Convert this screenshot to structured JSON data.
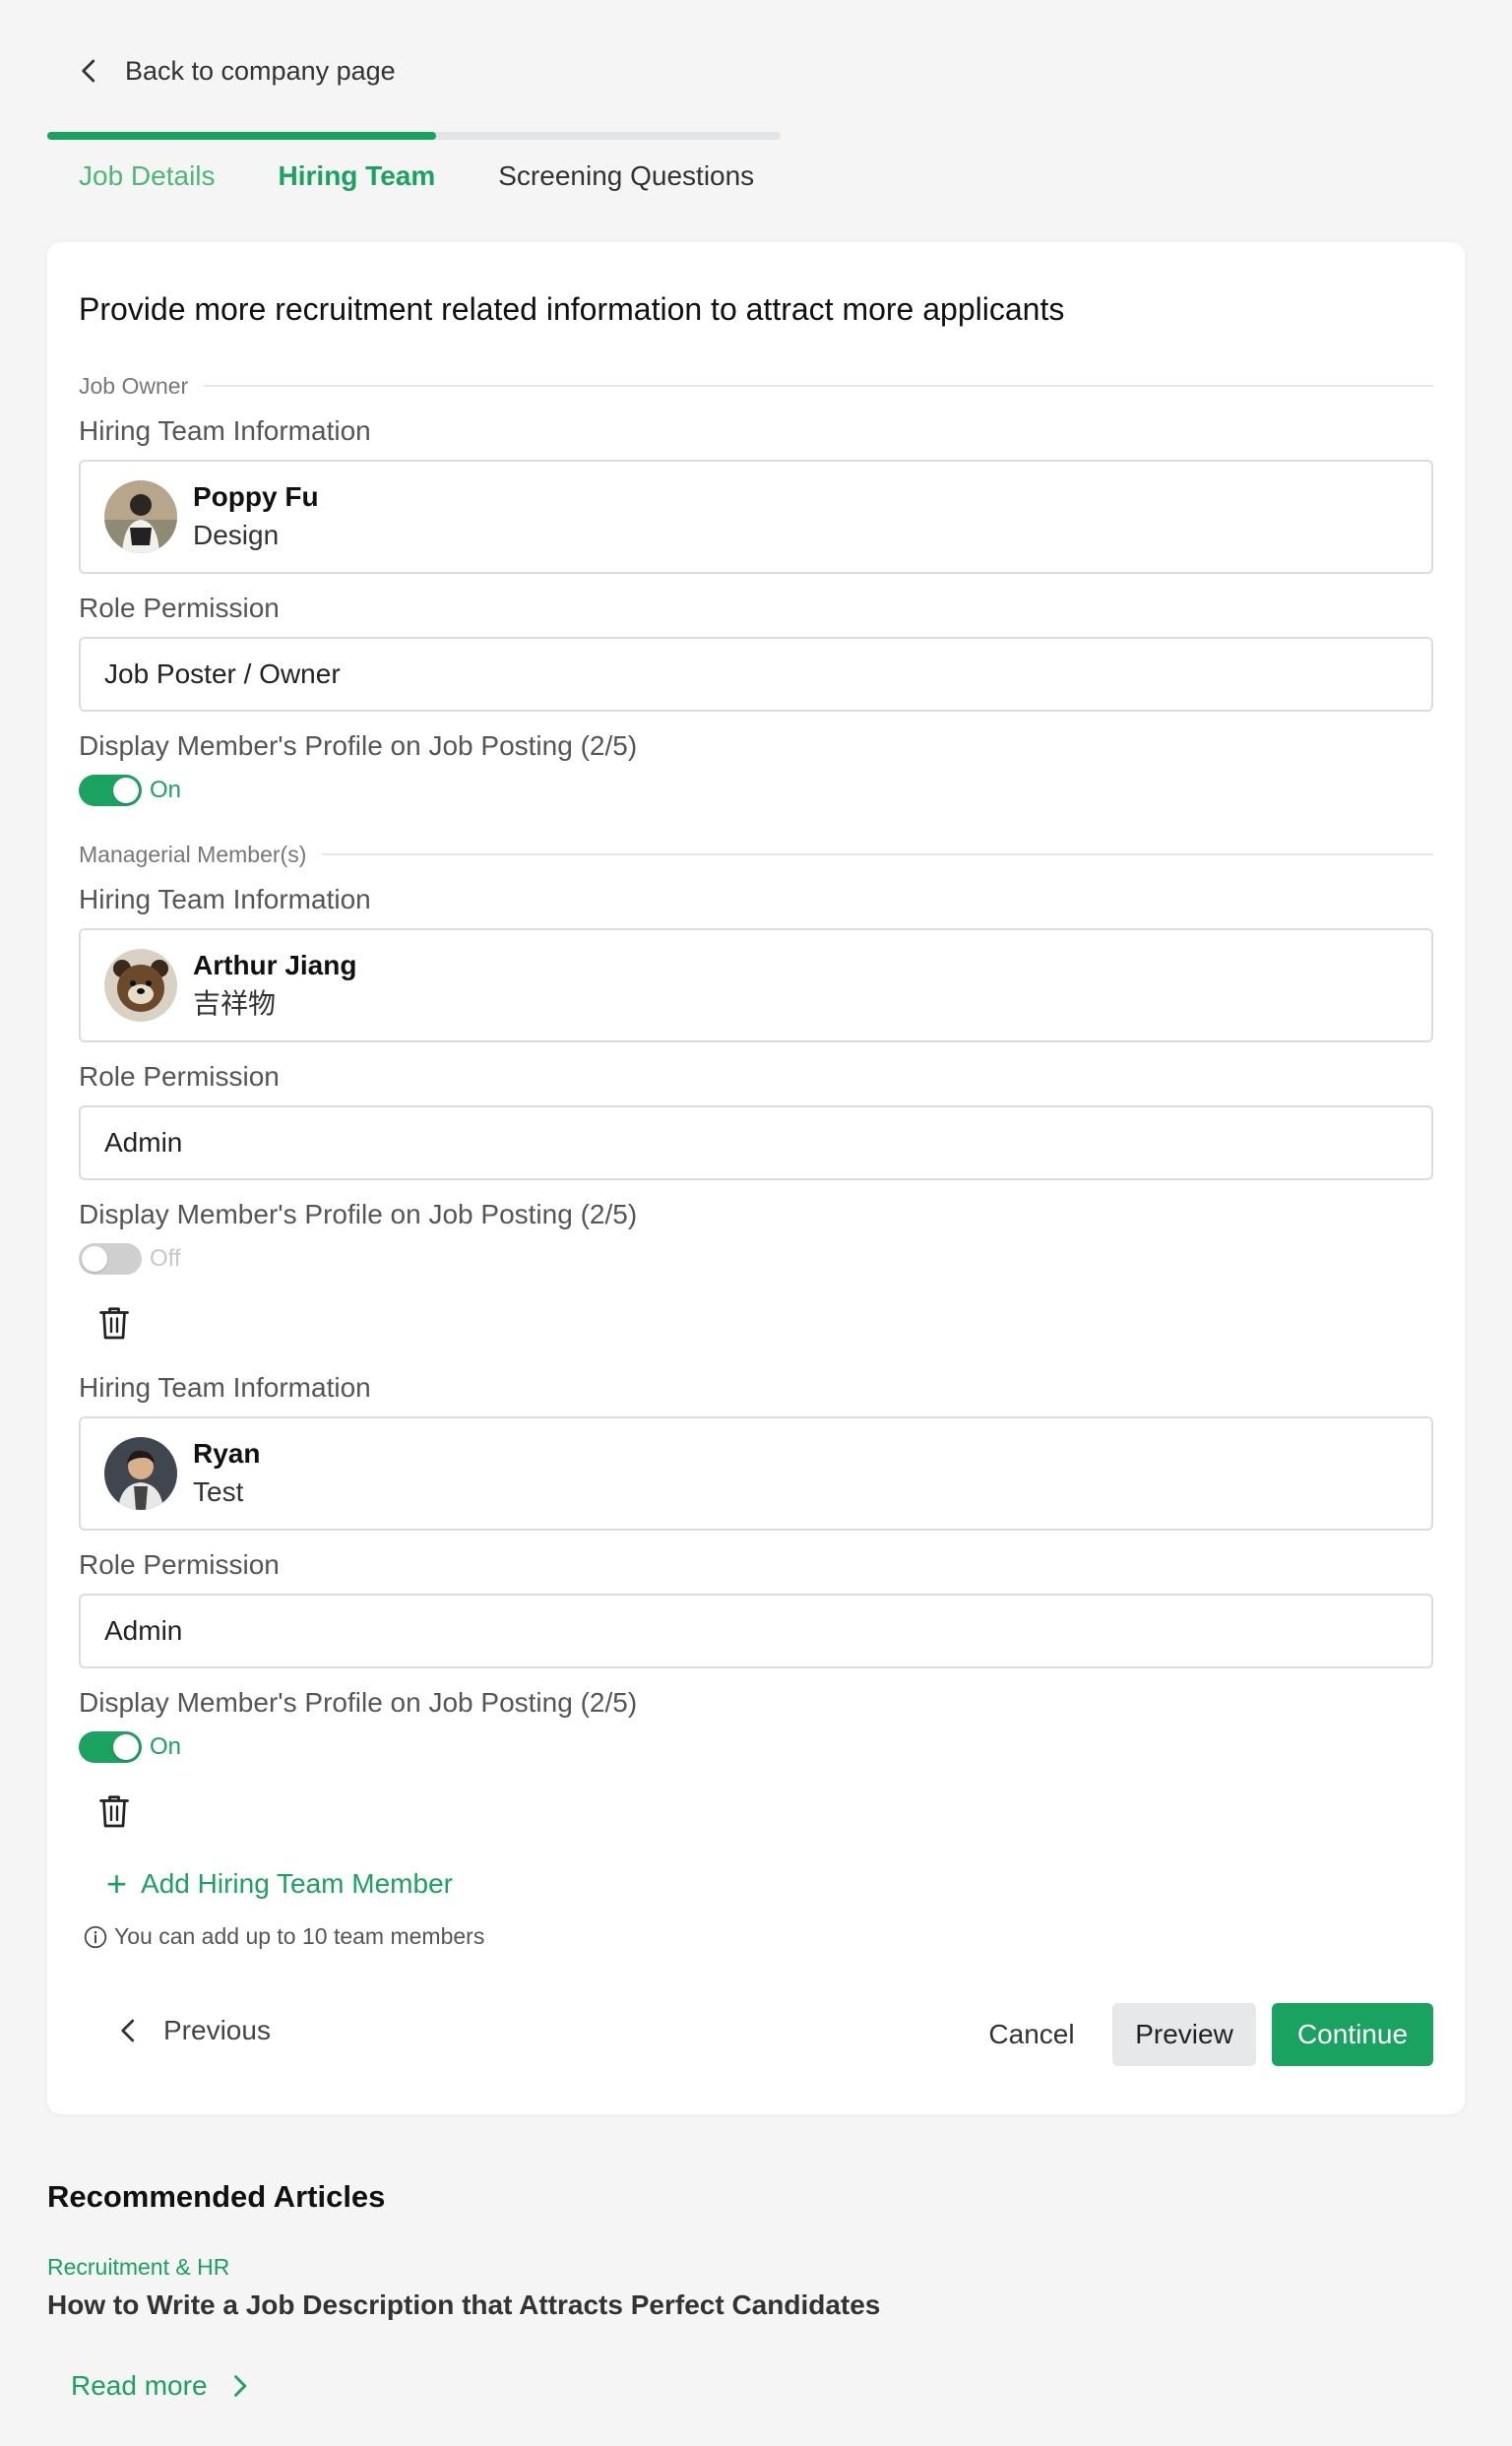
{
  "nav": {
    "back_label": "Back to company page"
  },
  "progress": {
    "completed_fraction": 0.53
  },
  "tabs": [
    {
      "label": "Job Details",
      "state": "done"
    },
    {
      "label": "Hiring Team",
      "state": "active"
    },
    {
      "label": "Screening Questions",
      "state": "todo"
    }
  ],
  "form": {
    "title": "Provide more recruitment related information to attract more applicants",
    "job_owner_section": "Job Owner",
    "managerial_section": "Managerial Member(s)",
    "members": [
      {
        "info_label": "Hiring Team Information",
        "name": "Poppy Fu",
        "department": "Design",
        "role_label": "Role Permission",
        "role": "Job Poster / Owner",
        "display_label": "Display Member's Profile on Job Posting (2/5)",
        "display_state": "On"
      },
      {
        "info_label": "Hiring Team Information",
        "name": "Arthur Jiang",
        "department": "吉祥物",
        "role_label": "Role Permission",
        "role": "Admin",
        "display_label": "Display Member's Profile on Job Posting (2/5)",
        "display_state": "Off"
      },
      {
        "info_label": "Hiring Team Information",
        "name": "Ryan",
        "department": "Test",
        "role_label": "Role Permission",
        "role": "Admin",
        "display_label": "Display Member's Profile on Job Posting (2/5)",
        "display_state": "On"
      }
    ],
    "add_member_label": "Add Hiring Team Member",
    "limit_hint": "You can add up to 10 team members"
  },
  "footer": {
    "previous_label": "Previous",
    "cancel_label": "Cancel",
    "preview_label": "Preview",
    "continue_label": "Continue"
  },
  "recommended": {
    "title": "Recommended Articles",
    "category": "Recruitment & HR",
    "article_title": "How to Write a Job Description that Attracts Perfect Candidates",
    "read_more_label": "Read more"
  },
  "colors": {
    "accent": "#1aa260",
    "background": "#f5f5f5",
    "switch_off": "#cfcfcf"
  }
}
